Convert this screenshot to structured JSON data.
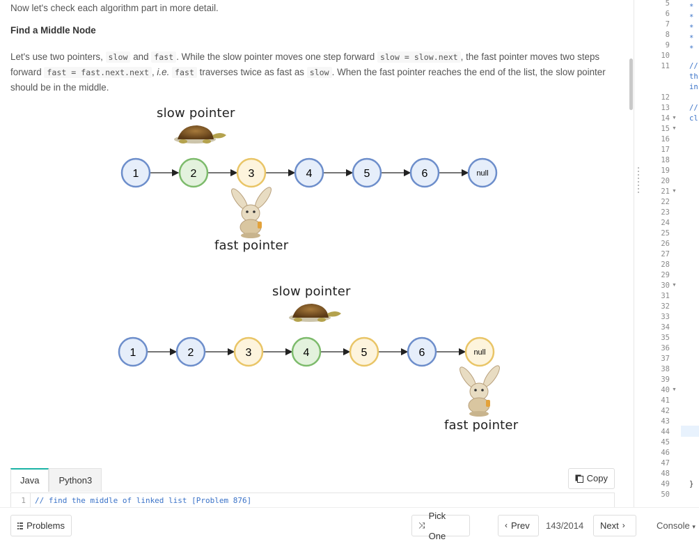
{
  "article": {
    "intro": "Now let's check each algorithm part in more detail.",
    "heading": "Find a Middle Node",
    "para": {
      "t1": "Let's use two pointers, ",
      "c_slow": "slow",
      "t2": " and ",
      "c_fast": "fast",
      "t3": ". While the slow pointer moves one step forward ",
      "c_slow_next": "slow = slow.next",
      "t4": ", the fast pointer moves two steps forward ",
      "c_fast_next": "fast = fast.next.next",
      "t5": ", ",
      "ie": "i.e.",
      "t6": " ",
      "c_fast2": "fast",
      "t7": " traverses twice as fast as ",
      "c_slow2": "slow",
      "t8": ". When the fast pointer reaches the end of the list, the slow pointer should be in the middle."
    }
  },
  "diagrams": [
    {
      "slow_label": "slow pointer",
      "fast_label": "fast pointer",
      "nodes": [
        "1",
        "2",
        "3",
        "4",
        "5",
        "6",
        "null"
      ],
      "slow_at": "2",
      "fast_at": "3"
    },
    {
      "slow_label": "slow pointer",
      "fast_label": "fast pointer",
      "nodes": [
        "1",
        "2",
        "3",
        "4",
        "5",
        "6",
        "null"
      ],
      "slow_at": "4",
      "fast_at": "null"
    }
  ],
  "colors": {
    "node_blue_fill": "#e6eefa",
    "node_blue_stroke": "#6d8ecb",
    "node_green_fill": "#e3f2dd",
    "node_green_stroke": "#7dbb6c",
    "node_yellow_fill": "#fdf4dd",
    "node_yellow_stroke": "#e9c567",
    "accent_tab": "#1bb3a5",
    "comment": "#3b73c8"
  },
  "code_tabs": {
    "tabs": [
      "Java",
      "Python3"
    ],
    "active": "Java",
    "copy_label": "Copy",
    "first_line_no": "1",
    "first_line": "// find the middle of linked list [Problem 876]"
  },
  "editor": {
    "lines": [
      "5",
      "6",
      "7",
      "8",
      "9",
      "10",
      "11",
      "12",
      "13",
      "14",
      "15",
      "16",
      "17",
      "18",
      "19",
      "20",
      "21",
      "22",
      "23",
      "24",
      "25",
      "26",
      "27",
      "28",
      "29",
      "30",
      "31",
      "32",
      "33",
      "34",
      "35",
      "36",
      "37",
      "38",
      "39",
      "40",
      "41",
      "42",
      "43",
      "44",
      "45",
      "46",
      "47",
      "48",
      "49",
      "50"
    ],
    "fold_lines": [
      "14",
      "15",
      "21",
      "30",
      "40"
    ],
    "text_fragments": {
      "star": "*",
      "l11": "//",
      "l11b": "th",
      "l11c": "in",
      "l13": "//",
      "l14": "cl",
      "l49": "}"
    }
  },
  "bottom": {
    "problems": "Problems",
    "pick_one": "Pick One",
    "prev": "Prev",
    "count": "143/2014",
    "next": "Next",
    "console": "Console"
  }
}
